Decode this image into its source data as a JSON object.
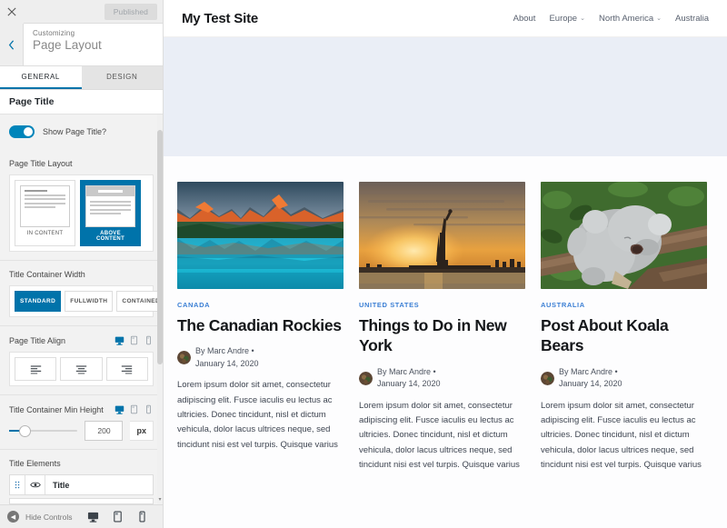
{
  "customizer": {
    "close_icon": "close-icon",
    "publish_label": "Published",
    "back_icon": "chevron-left-icon",
    "customizing_label": "Customizing",
    "panel_title": "Page Layout",
    "tabs": [
      {
        "label": "GENERAL",
        "active": true
      },
      {
        "label": "DESIGN",
        "active": false
      }
    ],
    "section_title": "Page Title",
    "show_page_title": {
      "label": "Show Page Title?",
      "enabled": true
    },
    "page_title_layout": {
      "label": "Page Title Layout",
      "options": [
        {
          "label": "IN CONTENT",
          "selected": false
        },
        {
          "label": "ABOVE CONTENT",
          "selected": true
        }
      ]
    },
    "title_container_width": {
      "label": "Title Container Width",
      "options": [
        {
          "label": "STANDARD",
          "selected": true
        },
        {
          "label": "FULLWIDTH",
          "selected": false
        },
        {
          "label": "CONTAINED",
          "selected": false
        }
      ]
    },
    "page_title_align": {
      "label": "Page Title Align",
      "devices": [
        {
          "name": "desktop-icon",
          "active": true
        },
        {
          "name": "tablet-icon",
          "active": false
        },
        {
          "name": "mobile-icon",
          "active": false
        }
      ],
      "options": [
        {
          "name": "align-left",
          "selected": false
        },
        {
          "name": "align-center",
          "selected": false
        },
        {
          "name": "align-right",
          "selected": false
        }
      ]
    },
    "title_container_min_height": {
      "label": "Title Container Min Height",
      "devices": [
        {
          "name": "desktop-icon",
          "active": true
        },
        {
          "name": "tablet-icon",
          "active": false
        },
        {
          "name": "mobile-icon",
          "active": false
        }
      ],
      "value": "200",
      "unit": "px"
    },
    "title_elements": {
      "label": "Title Elements",
      "items": [
        {
          "label": "Title",
          "visible": true
        }
      ]
    },
    "footer": {
      "hide_controls_label": "Hide Controls",
      "hide_icon": "collapse-arrow-icon",
      "devices": [
        {
          "name": "desktop-icon",
          "active": true
        },
        {
          "name": "tablet-icon",
          "active": false
        },
        {
          "name": "mobile-icon",
          "active": false
        }
      ]
    }
  },
  "preview": {
    "site_title": "My Test Site",
    "nav": [
      {
        "label": "About",
        "has_submenu": false
      },
      {
        "label": "Europe",
        "has_submenu": true
      },
      {
        "label": "North America",
        "has_submenu": true
      },
      {
        "label": "Australia",
        "has_submenu": false
      }
    ],
    "posts": [
      {
        "image": "mountain-lake-photo",
        "category": "CANADA",
        "title": "The Canadian Rockies",
        "author": "By Marc Andre",
        "separator": "•",
        "date": "January 14, 2020",
        "excerpt": "Lorem ipsum dolor sit amet, consectetur adipiscing elit. Fusce iaculis eu lectus ac ultricies. Donec tincidunt, nisl et dictum vehicula, dolor lacus ultrices neque, sed tincidunt nisi est vel turpis. Quisque varius"
      },
      {
        "image": "statue-of-liberty-sunset-photo",
        "category": "UNITED STATES",
        "title": "Things to Do in New York",
        "author": "By Marc Andre",
        "separator": "•",
        "date": "January 14, 2020",
        "excerpt": "Lorem ipsum dolor sit amet, consectetur adipiscing elit. Fusce iaculis eu lectus ac ultricies. Donec tincidunt, nisl et dictum vehicula, dolor lacus ultrices neque, sed tincidunt nisi est vel turpis. Quisque varius"
      },
      {
        "image": "koala-bear-photo",
        "category": "AUSTRALIA",
        "title": "Post About Koala Bears",
        "author": "By Marc Andre",
        "separator": "•",
        "date": "January 14, 2020",
        "excerpt": "Lorem ipsum dolor sit amet, consectetur adipiscing elit. Fusce iaculis eu lectus ac ultricies. Donec tincidunt, nisl et dictum vehicula, dolor lacus ultrices neque, sed tincidunt nisi est vel turpis. Quisque varius"
      }
    ]
  },
  "colors": {
    "accent": "#0073aa",
    "link": "#3b7fd4",
    "hero_bg": "#eaeef6"
  }
}
